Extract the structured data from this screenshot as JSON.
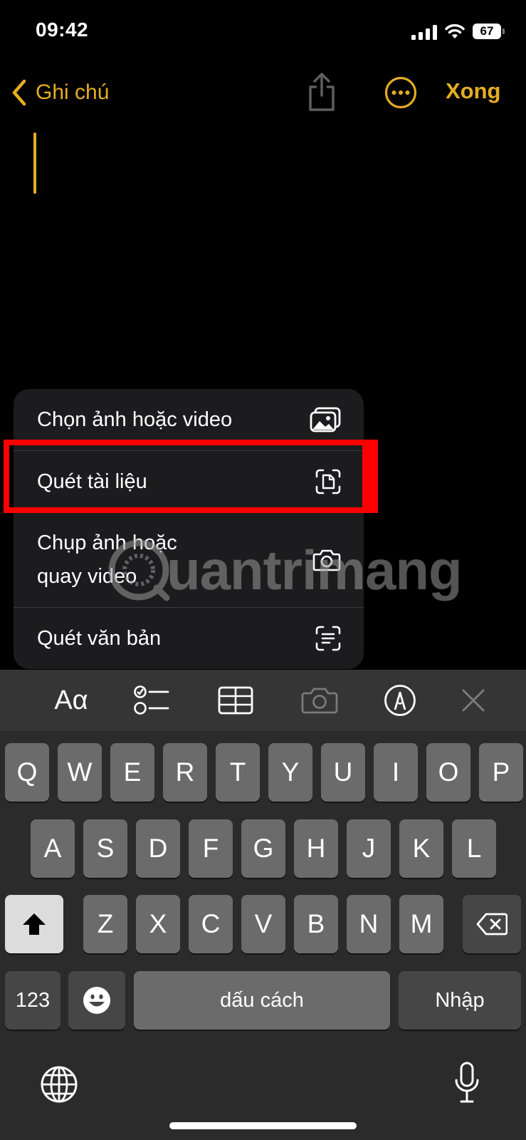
{
  "status": {
    "time": "09:42",
    "battery": "67"
  },
  "nav": {
    "back_label": "Ghi chú",
    "done_label": "Xong"
  },
  "menu": {
    "items": [
      {
        "label": "Chọn ảnh hoặc video",
        "icon": "photo-library-icon"
      },
      {
        "label": "Quét tài liệu",
        "icon": "document-scan-icon"
      },
      {
        "label_line1": "Chụp ảnh hoặc",
        "label_line2": "quay video",
        "icon": "camera-icon"
      },
      {
        "label": "Quét văn bản",
        "icon": "text-scan-icon"
      }
    ]
  },
  "watermark": {
    "text": "uantrimang"
  },
  "toolbar": {
    "format_label": "Aα",
    "icons": [
      "format-icon",
      "checklist-icon",
      "table-icon",
      "camera-icon",
      "markup-pen-icon",
      "close-icon"
    ]
  },
  "keyboard": {
    "row1": [
      "Q",
      "W",
      "E",
      "R",
      "T",
      "Y",
      "U",
      "I",
      "O",
      "P"
    ],
    "row2": [
      "A",
      "S",
      "D",
      "F",
      "G",
      "H",
      "J",
      "K",
      "L"
    ],
    "row3": [
      "Z",
      "X",
      "C",
      "V",
      "B",
      "N",
      "M"
    ],
    "numbers_label": "123",
    "space_label": "dấu cách",
    "return_label": "Nhập"
  },
  "colors": {
    "accent": "#E5AE22",
    "highlight": "#FF0000"
  }
}
